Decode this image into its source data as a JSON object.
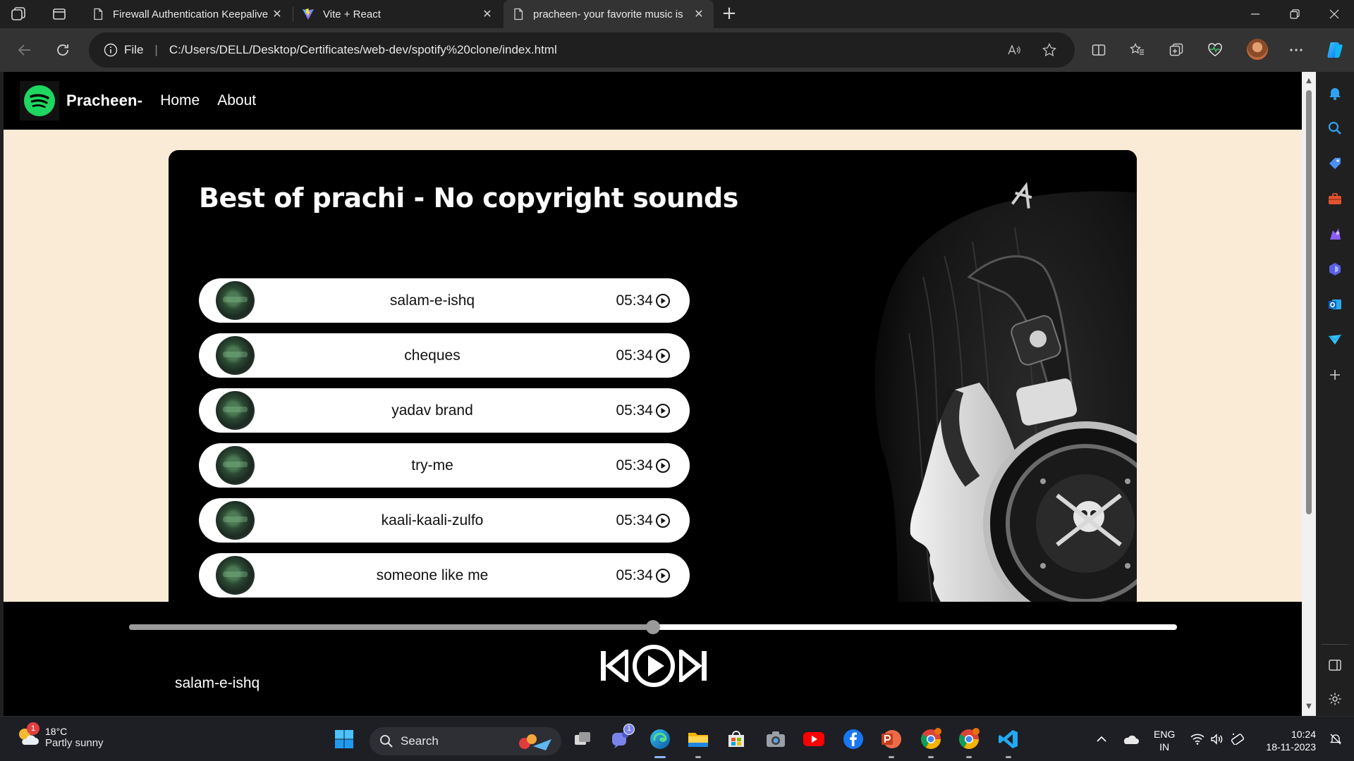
{
  "browser": {
    "tabs": [
      {
        "title": "Firewall Authentication Keepalive",
        "active": false
      },
      {
        "title": "Vite + React",
        "active": false
      },
      {
        "title": "pracheen- your favorite music is",
        "active": true
      }
    ],
    "address": {
      "scheme_label": "File",
      "url": "C:/Users/DELL/Desktop/Certificates/web-dev/spotify%20clone/index.html"
    }
  },
  "site": {
    "brand": "Pracheen-",
    "nav": {
      "home": "Home",
      "about": "About"
    },
    "heading": "Best of prachi - No copyright sounds",
    "songs": [
      {
        "name": "salam-e-ishq",
        "duration": "05:34"
      },
      {
        "name": "cheques",
        "duration": "05:34"
      },
      {
        "name": "yadav brand",
        "duration": "05:34"
      },
      {
        "name": "try-me",
        "duration": "05:34"
      },
      {
        "name": "kaali-kaali-zulfo",
        "duration": "05:34"
      },
      {
        "name": "someone like me",
        "duration": "05:34"
      }
    ]
  },
  "player": {
    "progress": 0.5,
    "now_playing": "salam-e-ishq"
  },
  "taskbar": {
    "weather": {
      "temp": "18°C",
      "desc": "Partly sunny",
      "badge": "1"
    },
    "search_label": "Search",
    "teams_badge": "1",
    "language": {
      "line1": "ENG",
      "line2": "IN"
    },
    "clock": {
      "time": "10:24",
      "date": "18-11-2023"
    }
  },
  "colors": {
    "page_bg": "#faebd7",
    "spotify_green": "#1ed760",
    "seek_fill": "#9a9a9a"
  }
}
